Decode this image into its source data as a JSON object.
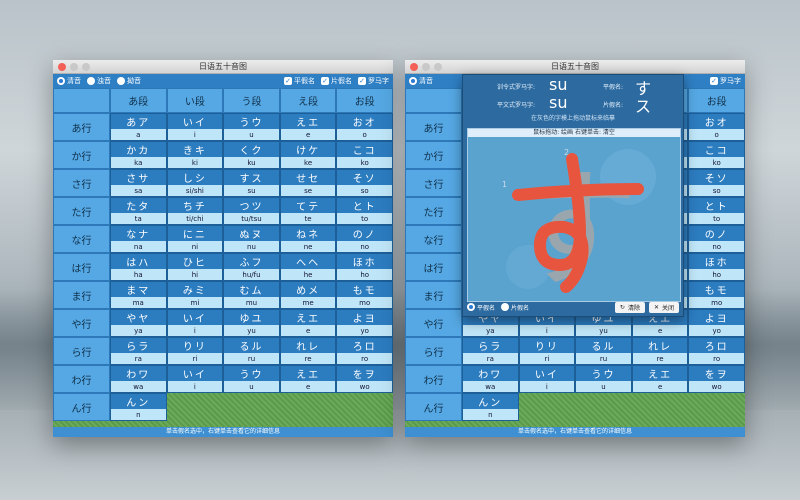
{
  "window_title": "日语五十音图",
  "toolbar": {
    "radio_seion": "清音",
    "radio_dakuon": "浊音",
    "radio_youon": "拗音",
    "check_hiragana": "平假名",
    "check_katakana": "片假名",
    "check_romaji": "罗马字"
  },
  "columns": [
    "あ段",
    "い段",
    "う段",
    "え段",
    "お段"
  ],
  "rows": [
    {
      "label": "あ行",
      "cells": [
        {
          "k": "あア",
          "r": "a"
        },
        {
          "k": "いイ",
          "r": "i"
        },
        {
          "k": "うウ",
          "r": "u"
        },
        {
          "k": "えエ",
          "r": "e"
        },
        {
          "k": "おオ",
          "r": "o"
        }
      ]
    },
    {
      "label": "か行",
      "cells": [
        {
          "k": "かカ",
          "r": "ka"
        },
        {
          "k": "きキ",
          "r": "ki"
        },
        {
          "k": "くク",
          "r": "ku"
        },
        {
          "k": "けケ",
          "r": "ke"
        },
        {
          "k": "こコ",
          "r": "ko"
        }
      ]
    },
    {
      "label": "さ行",
      "cells": [
        {
          "k": "さサ",
          "r": "sa"
        },
        {
          "k": "しシ",
          "r": "si/shi"
        },
        {
          "k": "すス",
          "r": "su"
        },
        {
          "k": "せセ",
          "r": "se"
        },
        {
          "k": "そソ",
          "r": "so"
        }
      ]
    },
    {
      "label": "た行",
      "cells": [
        {
          "k": "たタ",
          "r": "ta"
        },
        {
          "k": "ちチ",
          "r": "ti/chi"
        },
        {
          "k": "つツ",
          "r": "tu/tsu"
        },
        {
          "k": "てテ",
          "r": "te"
        },
        {
          "k": "とト",
          "r": "to"
        }
      ]
    },
    {
      "label": "な行",
      "cells": [
        {
          "k": "なナ",
          "r": "na"
        },
        {
          "k": "にニ",
          "r": "ni"
        },
        {
          "k": "ぬヌ",
          "r": "nu"
        },
        {
          "k": "ねネ",
          "r": "ne"
        },
        {
          "k": "のノ",
          "r": "no"
        }
      ]
    },
    {
      "label": "は行",
      "cells": [
        {
          "k": "はハ",
          "r": "ha"
        },
        {
          "k": "ひヒ",
          "r": "hi"
        },
        {
          "k": "ふフ",
          "r": "hu/fu"
        },
        {
          "k": "へヘ",
          "r": "he"
        },
        {
          "k": "ほホ",
          "r": "ho"
        }
      ]
    },
    {
      "label": "ま行",
      "cells": [
        {
          "k": "まマ",
          "r": "ma"
        },
        {
          "k": "みミ",
          "r": "mi"
        },
        {
          "k": "むム",
          "r": "mu"
        },
        {
          "k": "めメ",
          "r": "me"
        },
        {
          "k": "もモ",
          "r": "mo"
        }
      ]
    },
    {
      "label": "や行",
      "cells": [
        {
          "k": "やヤ",
          "r": "ya"
        },
        {
          "k": "いイ",
          "r": "i"
        },
        {
          "k": "ゆユ",
          "r": "yu"
        },
        {
          "k": "えエ",
          "r": "e"
        },
        {
          "k": "よヨ",
          "r": "yo"
        }
      ]
    },
    {
      "label": "ら行",
      "cells": [
        {
          "k": "らラ",
          "r": "ra"
        },
        {
          "k": "りリ",
          "r": "ri"
        },
        {
          "k": "るル",
          "r": "ru"
        },
        {
          "k": "れレ",
          "r": "re"
        },
        {
          "k": "ろロ",
          "r": "ro"
        }
      ]
    },
    {
      "label": "わ行",
      "cells": [
        {
          "k": "わワ",
          "r": "wa"
        },
        {
          "k": "いイ",
          "r": "i"
        },
        {
          "k": "うウ",
          "r": "u"
        },
        {
          "k": "えエ",
          "r": "e"
        },
        {
          "k": "をヲ",
          "r": "wo"
        }
      ]
    },
    {
      "label": "ん行",
      "cells": [
        {
          "k": "んン",
          "r": "n"
        }
      ]
    }
  ],
  "status_bar": "单击假名选中，右键单击查看它的详细信息",
  "popup": {
    "label_kunrei": "训令式罗马字:",
    "value_kunrei": "su",
    "label_hepburn": "平文式罗马字:",
    "value_hepburn": "su",
    "label_hiragana": "平假名:",
    "value_hiragana": "す",
    "label_katakana": "片假名:",
    "value_katakana": "ス",
    "hint": "在灰色的字模上拖动鼠标来临摹",
    "canvas_bar": "鼠标拖动: 绘画  右键单击: 清空",
    "big_char": "す",
    "stroke_1": "1",
    "stroke_2": "2",
    "radio_hiragana": "平假名",
    "radio_katakana": "片假名",
    "clear_button": "清除",
    "close_button": "关闭"
  },
  "colors": {
    "accent": "#2c7cc0",
    "stroke": "#e8553e",
    "guide": "#9aa6ad"
  }
}
